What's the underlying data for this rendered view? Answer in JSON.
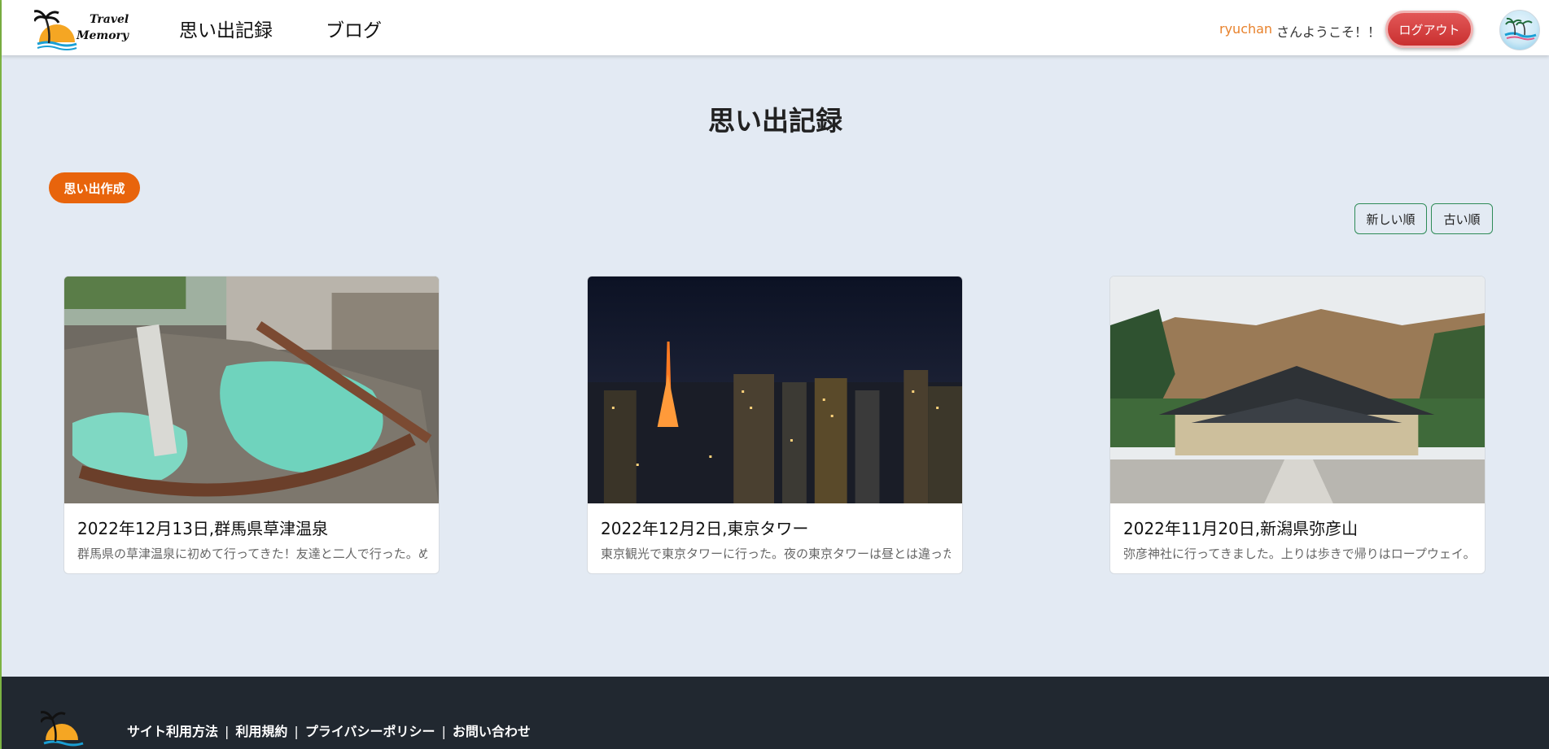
{
  "header": {
    "logo_line1": "Travel",
    "logo_line2": "Memory",
    "nav": [
      "思い出記録",
      "ブログ"
    ],
    "user_name": "ryuchan",
    "welcome": "さんようこそ！！",
    "logout": "ログアウト"
  },
  "main": {
    "title": "思い出記録",
    "create_button": "思い出作成",
    "sort_new": "新しい順",
    "sort_old": "古い順",
    "cards": [
      {
        "title": "2022年12月13日,群馬県草津温泉",
        "text": "群馬県の草津温泉に初めて行ってきた！友達と二人で行った。め...",
        "image_icon": "hot-spring-photo"
      },
      {
        "title": "2022年12月2日,東京タワー",
        "text": "東京観光で東京タワーに行った。夜の東京タワーは昼とは違った...",
        "image_icon": "tokyo-tower-night-photo"
      },
      {
        "title": "2022年11月20日,新潟県弥彦山",
        "text": "弥彦神社に行ってきました。上りは歩きで帰りはロープウェイ。...",
        "image_icon": "shrine-photo"
      }
    ]
  },
  "footer": {
    "links": [
      "サイト利用方法",
      "利用規約",
      "プライバシーポリシー",
      "お問い合わせ"
    ]
  },
  "colors": {
    "accent": "#e8640c",
    "logout": "#d43f3f",
    "page_bg": "#e3eaf3",
    "footer_bg": "#212830",
    "username": "#e8822c"
  }
}
